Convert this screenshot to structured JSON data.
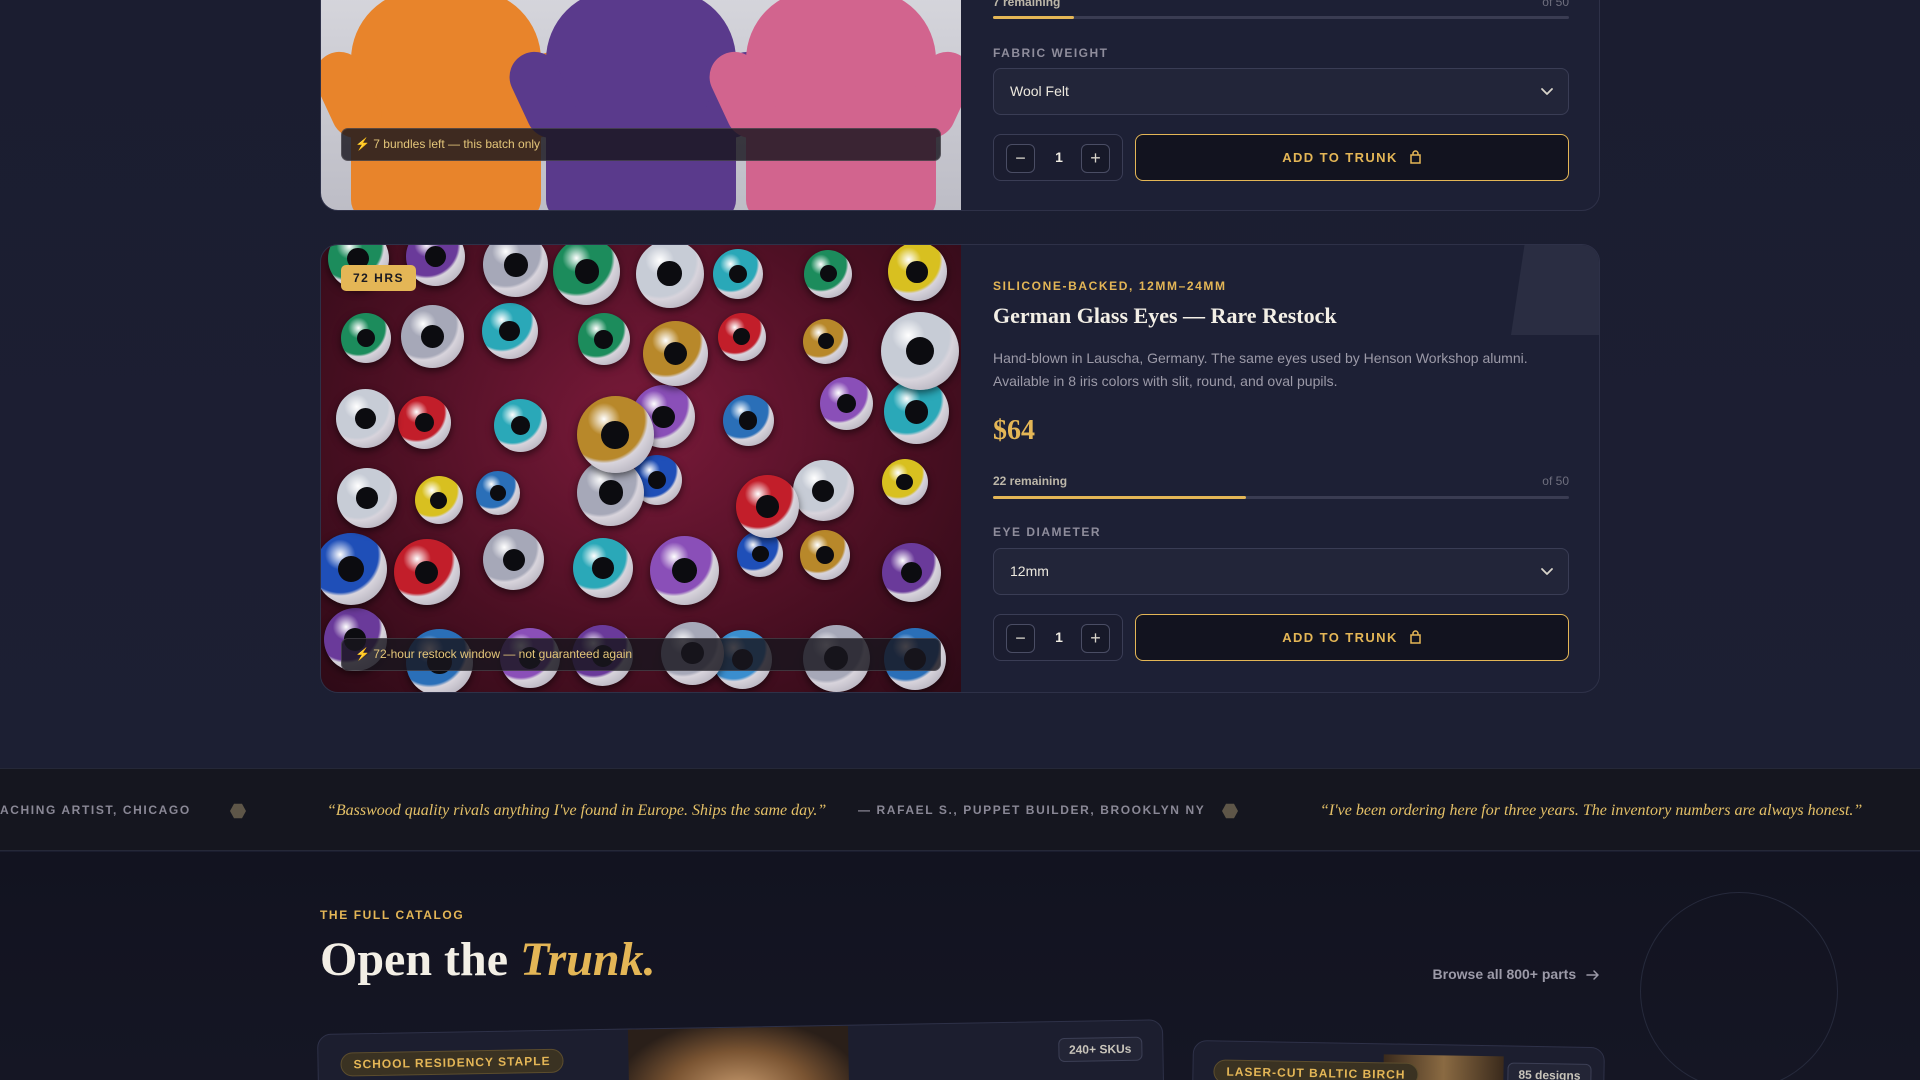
{
  "products": [
    {
      "image_caption": "⚡ 7 bundles left — this batch only",
      "stock_label": "7 remaining",
      "stock_total": "of 50",
      "stock_fraction": 0.14,
      "option_label": "FABRIC WEIGHT",
      "option_value": "Wool Felt",
      "quantity": "1",
      "add_label": "ADD TO TRUNK"
    },
    {
      "badge": "72 HRS",
      "eyebrow": "SILICONE-BACKED, 12MM–24MM",
      "title": "German Glass Eyes — Rare Restock",
      "description": "Hand-blown in Lauscha, Germany. The same eyes used by Henson Workshop alumni. Available in 8 iris colors with slit, round, and oval pupils.",
      "price": "$64",
      "stock_label": "22 remaining",
      "stock_total": "of 50",
      "stock_fraction": 0.44,
      "option_label": "EYE DIAMETER",
      "option_value": "12mm",
      "quantity": "1",
      "add_label": "ADD TO TRUNK",
      "image_caption": "⚡ 72-hour restock window — not guaranteed again"
    }
  ],
  "testimonials": {
    "items": [
      {
        "attr": "ACHING ARTIST, CHICAGO"
      },
      {
        "quote": "“Basswood quality rivals anything I've found in Europe. Ships the same day.”",
        "attr": "— RAFAEL S., PUPPET BUILDER, BROOKLYN NY"
      },
      {
        "quote": "“I've been ordering here for three years. The inventory numbers are always honest.”"
      }
    ]
  },
  "catalog": {
    "eyebrow": "THE FULL CATALOG",
    "heading_plain": "Open the ",
    "heading_em": "Trunk.",
    "browse_label": "Browse all 800+ parts",
    "tiles": [
      {
        "pill": "SCHOOL RESIDENCY STAPLE",
        "count": "240+ SKUs"
      },
      {
        "pill": "LASER-CUT BALTIC BIRCH",
        "count": "85 designs"
      }
    ]
  },
  "colors": {
    "accent": "#e4b656",
    "background": "#1a1c2e",
    "card": "#1d2035"
  },
  "icons": [
    "minus-icon",
    "plus-icon",
    "chevron-down-icon",
    "bag-icon",
    "arrow-right-icon",
    "hexagon-icon",
    "lightning-icon"
  ]
}
